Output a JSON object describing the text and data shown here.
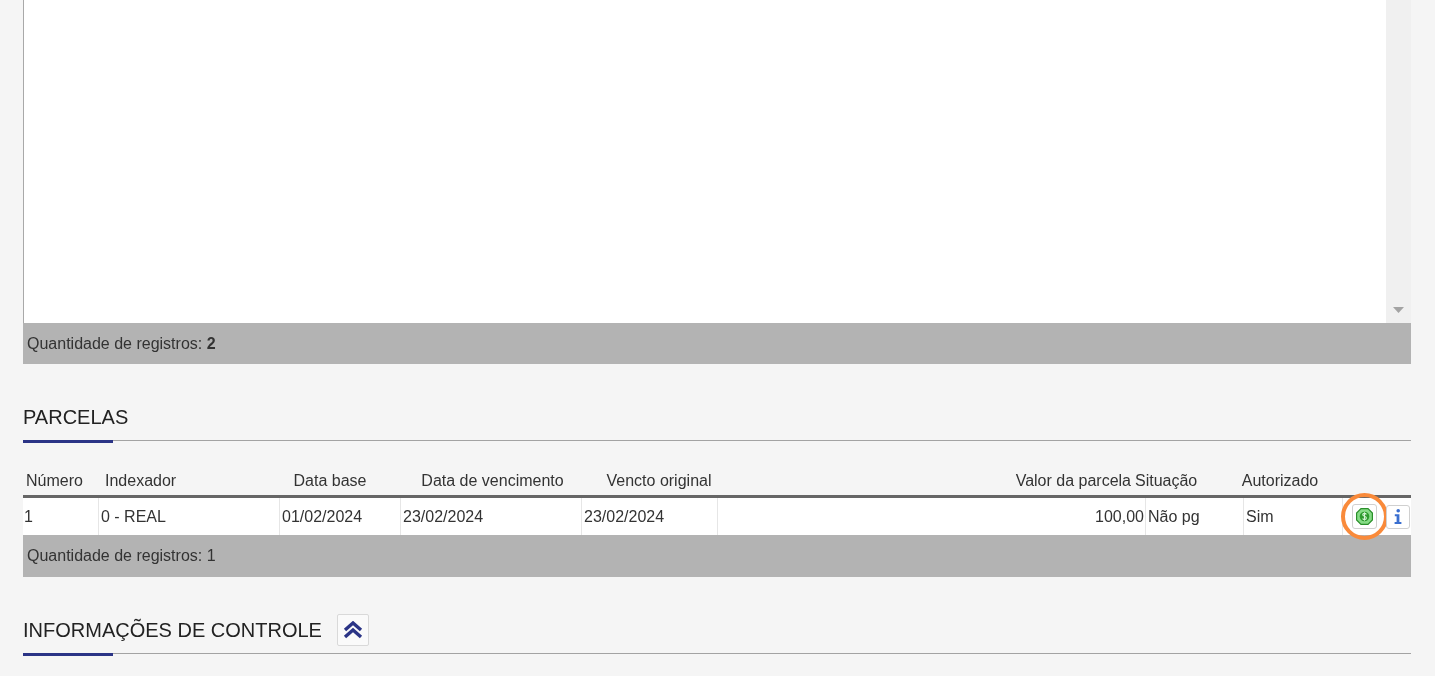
{
  "list": {
    "record_count": "Quantidade de registros: **2**"
  },
  "parcelas": {
    "title": "PARCELAS",
    "columns": [
      "Número",
      "Indexador",
      "Data base",
      "Data de vencimento",
      "Vencto original",
      "Valor da parcela",
      "Situação",
      "Autorizado"
    ],
    "rows": [
      {
        "cells": [
          "1",
          "0 - REAL",
          "01/02/2024",
          "23/02/2024",
          "23/02/2024",
          "100,00",
          "Não pg",
          "Sim"
        ],
        "actions": [
          {
            "kind": "pay",
            "highlighted": true
          },
          {
            "kind": "info",
            "highlighted": false
          }
        ]
      }
    ],
    "record_count": "Quantidade de registros: 1"
  },
  "controle": {
    "title": "INFORMAÇÕES DE CONTROLE",
    "expanded": true
  }
}
